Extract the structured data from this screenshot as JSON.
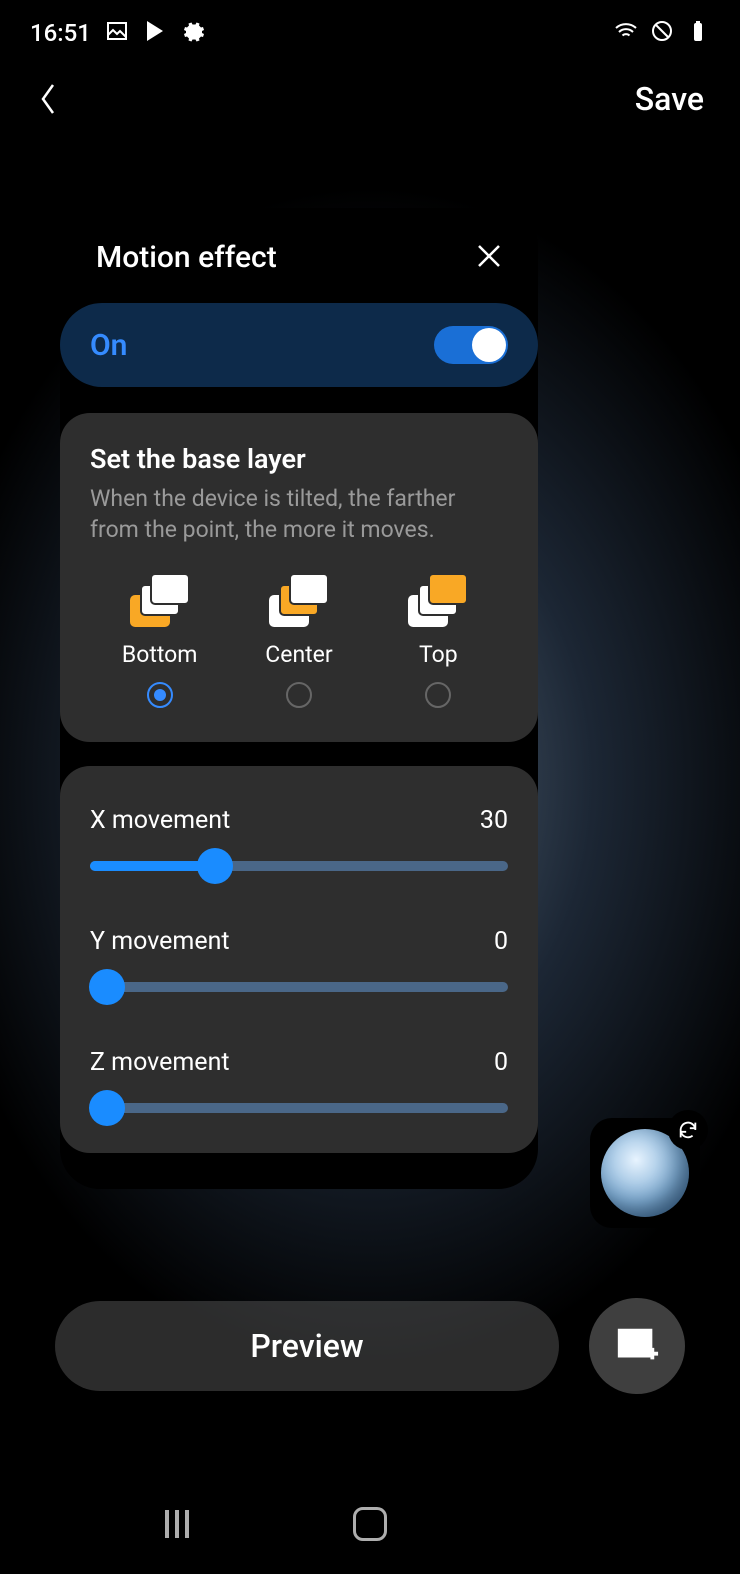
{
  "status": {
    "time": "16:51"
  },
  "header": {
    "save_label": "Save"
  },
  "card": {
    "title": "Motion effect",
    "toggle": {
      "label": "On",
      "value": true
    },
    "base_layer": {
      "title": "Set the base layer",
      "description": "When the device is tilted, the farther from the point, the more it moves.",
      "options": [
        {
          "label": "Bottom",
          "selected": true
        },
        {
          "label": "Center",
          "selected": false
        },
        {
          "label": "Top",
          "selected": false
        }
      ]
    },
    "sliders": [
      {
        "label": "X movement",
        "value": 30,
        "percent": 30
      },
      {
        "label": "Y movement",
        "value": 0,
        "percent": 0
      },
      {
        "label": "Z movement",
        "value": 0,
        "percent": 0
      }
    ]
  },
  "preview": {
    "label": "Preview"
  }
}
